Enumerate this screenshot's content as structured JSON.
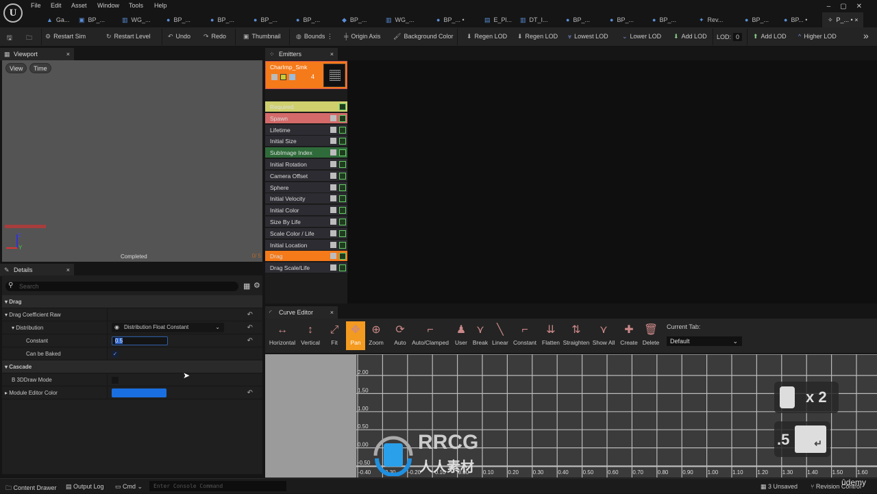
{
  "menu": [
    "File",
    "Edit",
    "Asset",
    "Window",
    "Tools",
    "Help"
  ],
  "tabs": [
    "Ga...",
    "BP_...",
    "WG_...",
    "BP_...",
    "BP_...",
    "BP_...",
    "BP_...",
    "BP_...",
    "WG_...",
    "BP_... •",
    "E_Pl...",
    "DT_I...",
    "BP_...",
    "BP_...",
    "BP_...",
    "Rev...",
    "BP_...",
    "BP... •"
  ],
  "active_tab": "P_... • ×",
  "toolbar": {
    "restart_sim": "Restart Sim",
    "restart_level": "Restart Level",
    "undo": "Undo",
    "redo": "Redo",
    "thumbnail": "Thumbnail",
    "bounds": "Bounds",
    "origin_axis": "Origin Axis",
    "background_color": "Background Color",
    "regen_lod1": "Regen LOD",
    "regen_lod2": "Regen LOD",
    "lowest_lod": "Lowest LOD",
    "lower_lod": "Lower LOD",
    "add_lod1": "Add LOD",
    "lod_label": "LOD:",
    "lod_value": "0",
    "add_lod2": "Add LOD",
    "higher_lod": "Higher LOD"
  },
  "viewport": {
    "title": "Viewport",
    "view": "View",
    "time": "Time",
    "status": "Completed",
    "stats": "0/ 5"
  },
  "details": {
    "title": "Details",
    "search_placeholder": "Search",
    "rows": {
      "drag": "Drag",
      "drag_coef": "Drag Coefficient Raw",
      "distribution": "Distribution",
      "distribution_value": "Distribution Float Constant",
      "constant": "Constant",
      "constant_value": "0.5",
      "can_be_baked": "Can be Baked",
      "cascade": "Cascade",
      "b3d": "B 3DDraw Mode",
      "module_color": "Module Editor Color"
    },
    "module_color": "#1a6fe0"
  },
  "emitters": {
    "title": "Emitters",
    "emitter_name": "CharImp_Smk",
    "emitter_count": "4",
    "modules": [
      {
        "label": "Required",
        "color": "#cfcf6e"
      },
      {
        "label": "Spawn",
        "color": "#d46a6a"
      },
      {
        "label": "Lifetime",
        "color": "#2c2c32"
      },
      {
        "label": "Initial Size",
        "color": "#2c2c32"
      },
      {
        "label": "SubImage Index",
        "color": "#2f6b3a"
      },
      {
        "label": "Initial Rotation",
        "color": "#2c2c32"
      },
      {
        "label": "Camera Offset",
        "color": "#2c2c32"
      },
      {
        "label": "Sphere",
        "color": "#2c2c32"
      },
      {
        "label": "Initial Velocity",
        "color": "#2c2c32"
      },
      {
        "label": "Initial Color",
        "color": "#2c2c32"
      },
      {
        "label": "Size By Life",
        "color": "#2c2c32"
      },
      {
        "label": "Scale Color / Life",
        "color": "#2c2c32"
      },
      {
        "label": "Initial Location",
        "color": "#2c2c32"
      },
      {
        "label": "Drag",
        "color": "#f47a1a"
      },
      {
        "label": "Drag Scale/Life",
        "color": "#2c2c32"
      }
    ]
  },
  "curve_editor": {
    "title": "Curve Editor",
    "buttons": [
      "Horizontal",
      "Vertical",
      "Fit",
      "Pan",
      "Zoom",
      "Auto",
      "Auto/Clamped",
      "User",
      "Break",
      "Linear",
      "Constant",
      "Flatten",
      "Straighten",
      "Show All",
      "Create",
      "Delete"
    ],
    "active_button": "Pan",
    "current_tab_label": "Current Tab:",
    "current_tab_value": "Default",
    "y_ticks": [
      "2.00",
      "1.50",
      "1.00",
      "0.50",
      "0.00",
      "-0.50"
    ],
    "x_ticks": [
      "-0.40",
      "-0.30",
      "-0.20",
      "-0.10",
      "0.00",
      "0.10",
      "0.20",
      "0.30",
      "0.40",
      "0.50",
      "0.60",
      "0.70",
      "0.80",
      "0.90",
      "1.00",
      "1.10",
      "1.20",
      "1.30",
      "1.40",
      "1.50",
      "1.60"
    ]
  },
  "key_hints": {
    "mouse": "x 2",
    "typed": ".5"
  },
  "watermark": {
    "brand": "RRCG",
    "sub": "人人素材",
    "udemy": "ûdemy"
  },
  "statusbar": {
    "content_drawer": "Content Drawer",
    "output_log": "Output Log",
    "cmd": "Cmd",
    "console_placeholder": "Enter Console Command",
    "unsaved": "3 Unsaved",
    "revision": "Revision Control"
  }
}
